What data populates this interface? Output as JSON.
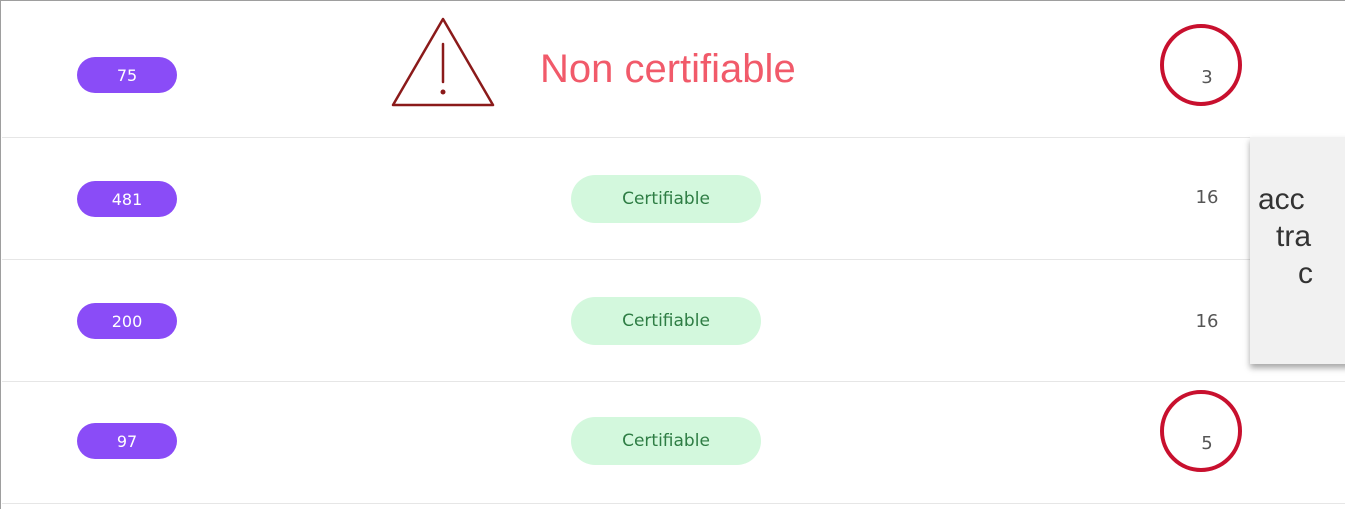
{
  "rows": [
    {
      "id": "75",
      "status": "Non certifiable",
      "count": "3",
      "status_color": "#f15a6a"
    },
    {
      "id": "481",
      "status": "Certifiable",
      "count": "16"
    },
    {
      "id": "200",
      "status": "Certifiable",
      "count": "16"
    },
    {
      "id": "97",
      "status": "Certifiable",
      "count": "5"
    }
  ],
  "annotations": {
    "warning_icon": "warning-triangle-icon",
    "highlight_color": "#c8102e"
  },
  "tooltip": {
    "lines": [
      "acc",
      "tra",
      "c"
    ]
  },
  "colors": {
    "id_badge": "#8a4cf7",
    "certifiable_bg": "#d3f8dd",
    "certifiable_text": "#2e7d44"
  }
}
